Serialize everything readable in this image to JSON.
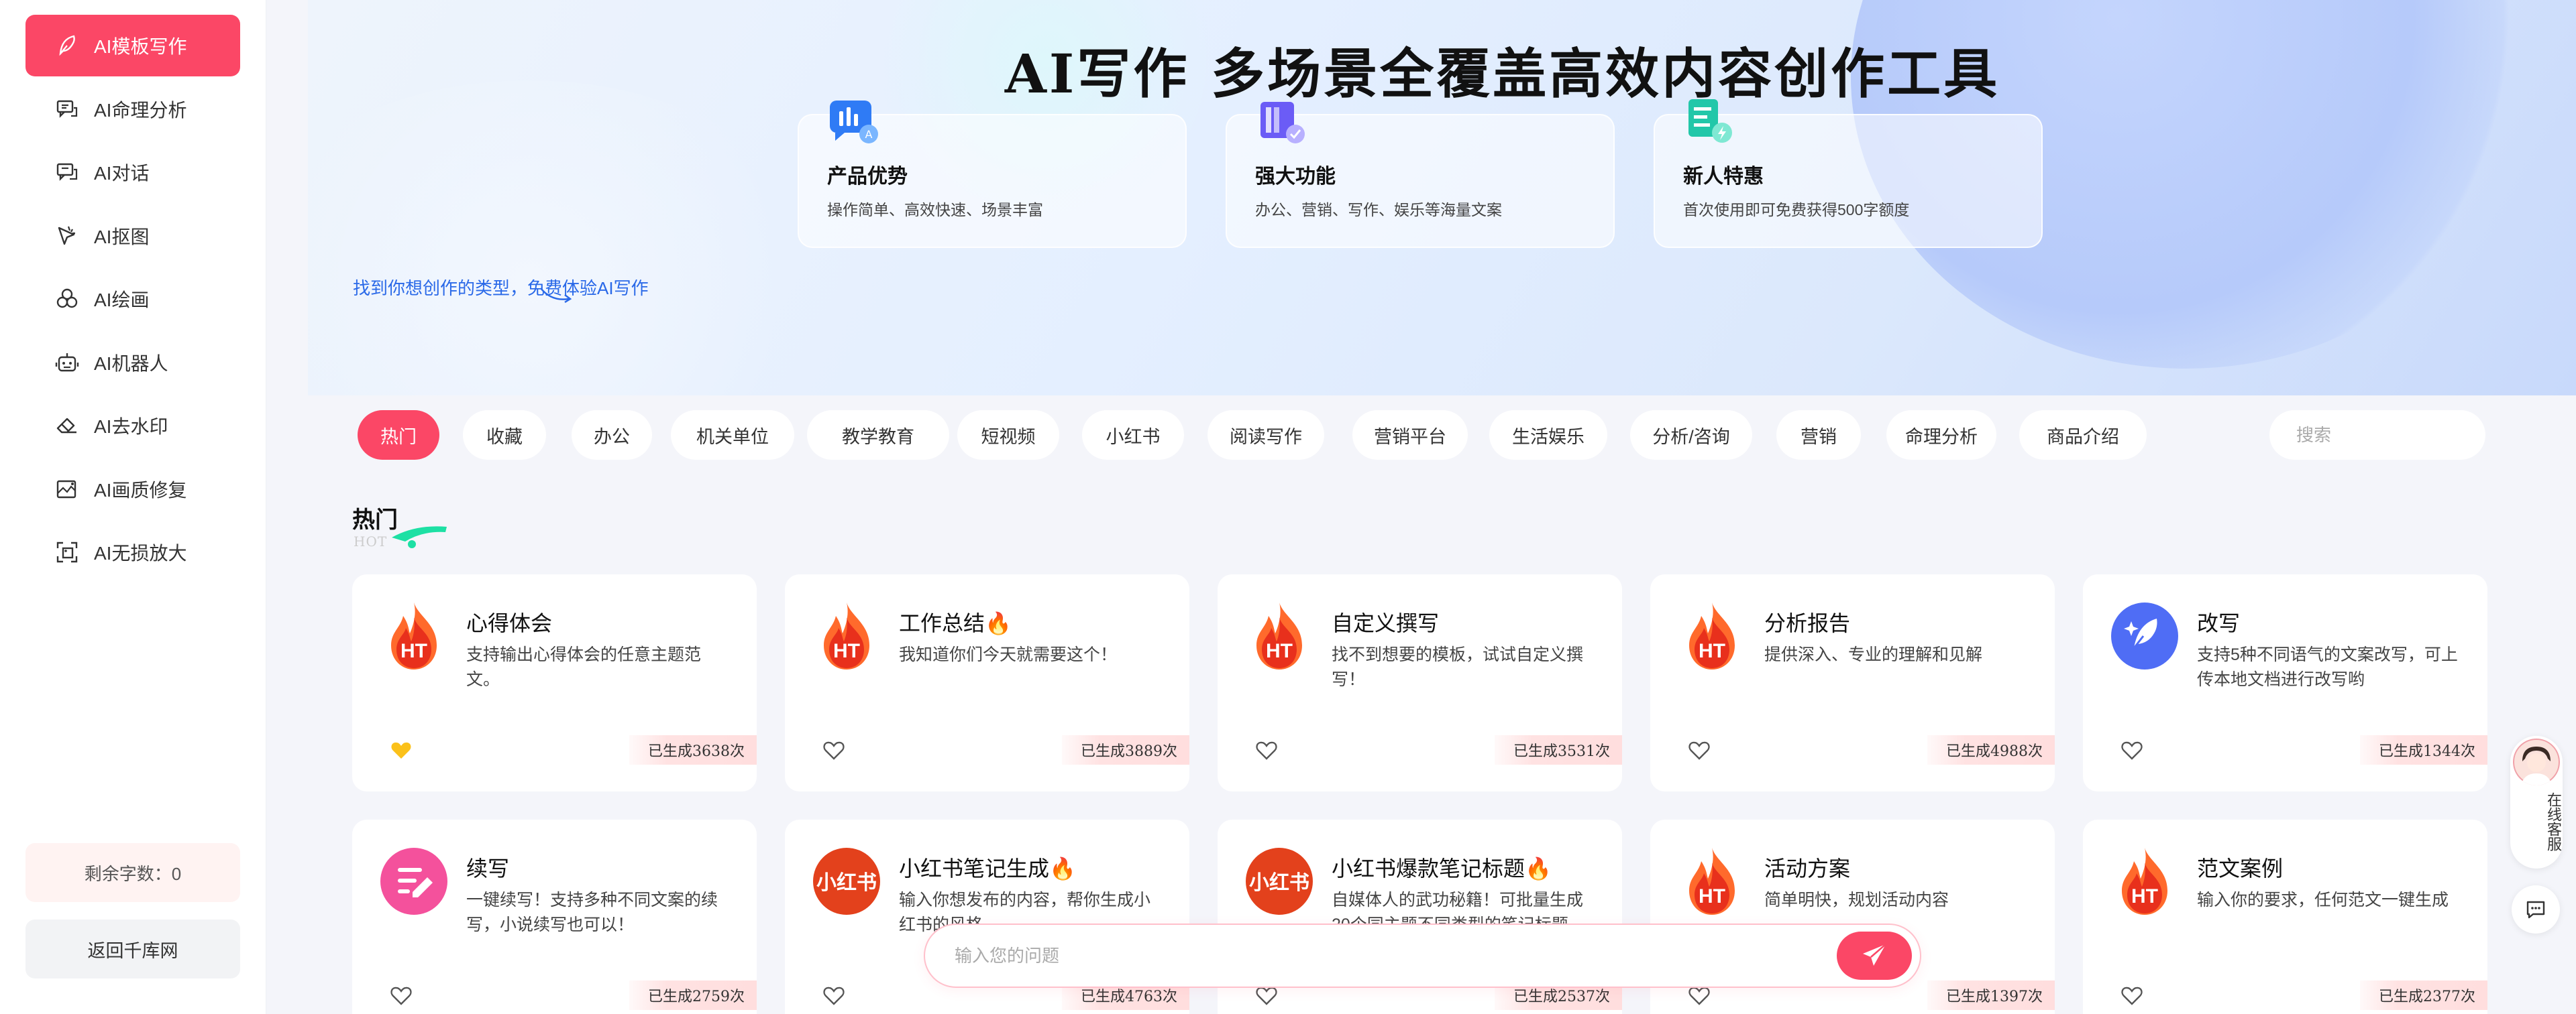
{
  "sidebar": {
    "items": [
      {
        "label": "AI模板写作",
        "icon": "feather-icon",
        "active": true
      },
      {
        "label": "AI命理分析",
        "icon": "chat-analysis-icon",
        "active": false
      },
      {
        "label": "AI对话",
        "icon": "chat-bubble-icon",
        "active": false
      },
      {
        "label": "AI抠图",
        "icon": "cutout-icon",
        "active": false
      },
      {
        "label": "AI绘画",
        "icon": "palette-circles-icon",
        "active": false
      },
      {
        "label": "AI机器人",
        "icon": "robot-icon",
        "active": false
      },
      {
        "label": "AI去水印",
        "icon": "eraser-icon",
        "active": false
      },
      {
        "label": "AI画质修复",
        "icon": "image-repair-icon",
        "active": false
      },
      {
        "label": "AI无损放大",
        "icon": "enlarge-icon",
        "active": false
      }
    ],
    "remaining_label": "剩余字数：0",
    "back_label": "返回千库网",
    "accent": "#fb4766"
  },
  "banner": {
    "title": "AI写作 多场景全覆盖高效内容创作工具",
    "features": [
      {
        "title": "产品优势",
        "desc": "操作简单、高效快速、场景丰富",
        "icon": "chart-bubble-icon"
      },
      {
        "title": "强大功能",
        "desc": "办公、营销、写作、娱乐等海量文案",
        "icon": "book-stack-icon"
      },
      {
        "title": "新人特惠",
        "desc": "首次使用即可免费获得500字额度",
        "icon": "document-lightning-icon"
      }
    ],
    "tip": "找到你想创作的类型，免费体验AI写作"
  },
  "tabs": [
    "热门",
    "收藏",
    "办公",
    "机关单位",
    "教学教育",
    "短视频",
    "小红书",
    "阅读写作",
    "营销平台",
    "生活娱乐",
    "分析/咨询",
    "营销",
    "命理分析",
    "商品介绍"
  ],
  "active_tab": "热门",
  "search": {
    "placeholder": "搜索"
  },
  "section": {
    "title": "热门",
    "subtitle": "HOT"
  },
  "cards": [
    {
      "title": "心得体会",
      "desc": "支持输出心得体会的任意主题范文。",
      "count": "已生成3638次",
      "icon": "ht-flame-icon",
      "favorited": true
    },
    {
      "title": "工作总结🔥",
      "desc": "我知道你们今天就需要这个！",
      "count": "已生成3889次",
      "icon": "ht-flame-icon",
      "favorited": false
    },
    {
      "title": "自定义撰写",
      "desc": "找不到想要的模板，试试自定义撰写！",
      "count": "已生成3531次",
      "icon": "ht-flame-icon",
      "favorited": false
    },
    {
      "title": "分析报告",
      "desc": "提供深入、专业的理解和见解",
      "count": "已生成4988次",
      "icon": "ht-flame-icon",
      "favorited": false
    },
    {
      "title": "改写",
      "desc": "支持5种不同语气的文案改写，可上传本地文档进行改写哟",
      "count": "已生成1344次",
      "icon": "sparkle-feather-icon",
      "favorited": false
    },
    {
      "title": "续写",
      "desc": "一键续写！支持多种不同文案的续写，小说续写也可以！",
      "count": "已生成2759次",
      "icon": "continue-write-icon",
      "favorited": false
    },
    {
      "title": "小红书笔记生成🔥",
      "desc": "输入你想发布的内容，帮你生成小红书的风格",
      "count": "已生成4763次",
      "icon": "xiaohongshu-icon",
      "favorited": false
    },
    {
      "title": "小红书爆款笔记标题🔥",
      "desc": "自媒体人的武功秘籍！可批量生成20个同主题不同类型的笔记标题",
      "count": "已生成2537次",
      "icon": "xiaohongshu-icon",
      "favorited": false
    },
    {
      "title": "活动方案",
      "desc": "简单明快，规划活动内容",
      "count": "已生成1397次",
      "icon": "ht-flame-icon",
      "favorited": false
    },
    {
      "title": "范文案例",
      "desc": "输入你的要求，任何范文一键生成",
      "count": "已生成2377次",
      "icon": "ht-flame-icon",
      "favorited": false
    }
  ],
  "chat": {
    "placeholder": "输入您的问题"
  },
  "service": {
    "label": "在线客服"
  },
  "icon_texts": {
    "ht": "HT",
    "xhs": "小红书"
  }
}
